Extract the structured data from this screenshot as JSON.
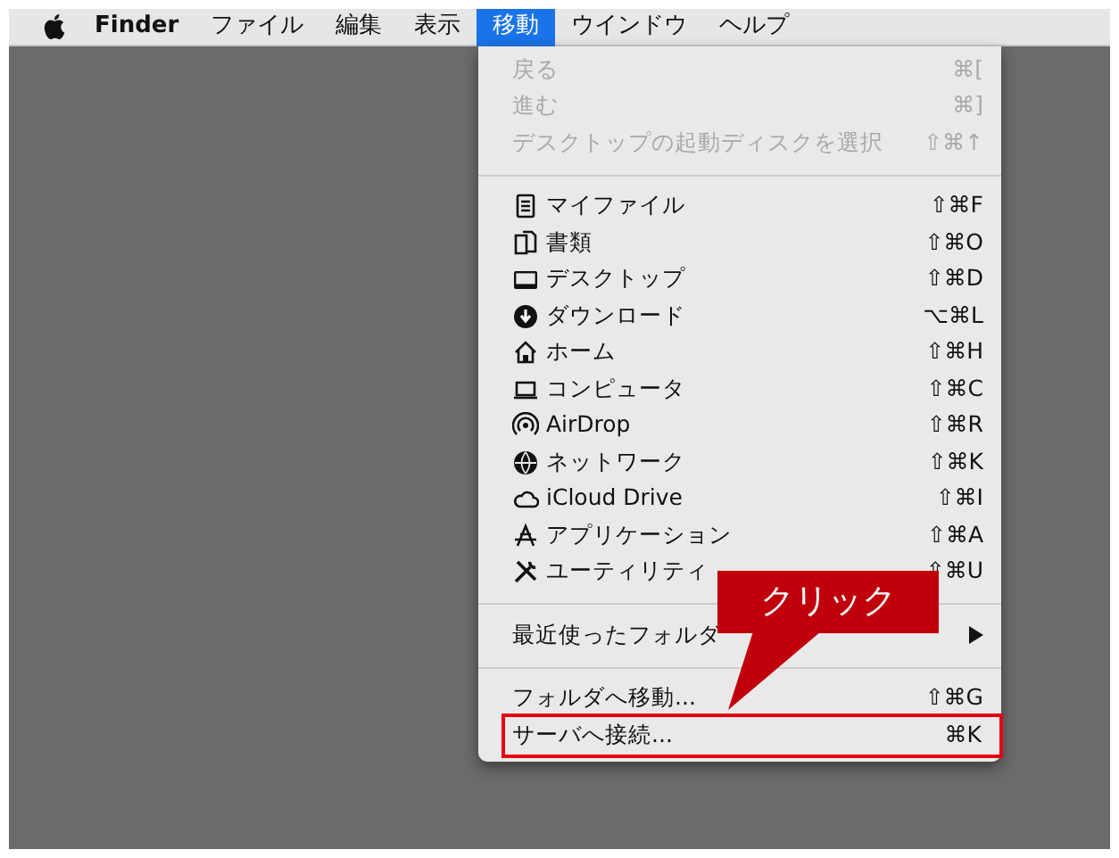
{
  "menubar": [
    {
      "label": "Finder",
      "kind": "app",
      "selected": false
    },
    {
      "label": "ファイル",
      "kind": "menu",
      "selected": false
    },
    {
      "label": "編集",
      "kind": "menu",
      "selected": false
    },
    {
      "label": "表示",
      "kind": "menu",
      "selected": false
    },
    {
      "label": "移動",
      "kind": "menu",
      "selected": true
    },
    {
      "label": "ウインドウ",
      "kind": "menu",
      "selected": false
    },
    {
      "label": "ヘルプ",
      "kind": "menu",
      "selected": false
    }
  ],
  "menu": {
    "items": [
      {
        "kind": "item",
        "label": "戻る",
        "shortcut": "⌘[",
        "disabled": true,
        "marked": false
      },
      {
        "kind": "item",
        "label": "進む",
        "shortcut": "⌘]",
        "disabled": true,
        "marked": false
      },
      {
        "kind": "item",
        "label": "デスクトップの起動ディスクを選択",
        "shortcut": "⇧⌘↑",
        "disabled": true,
        "marked": false
      },
      {
        "kind": "separator"
      },
      {
        "kind": "place",
        "label": "マイファイル",
        "shortcut": "⇧⌘F",
        "disabled": false,
        "marked": false
      },
      {
        "kind": "place",
        "label": "書類",
        "shortcut": "⇧⌘O",
        "disabled": false,
        "marked": false
      },
      {
        "kind": "place",
        "label": "デスクトップ",
        "shortcut": "⇧⌘D",
        "disabled": false,
        "marked": false
      },
      {
        "kind": "place",
        "label": "ダウンロード",
        "shortcut": "⌥⌘L",
        "disabled": false,
        "marked": false
      },
      {
        "kind": "place",
        "label": "ホーム",
        "shortcut": "⇧⌘H",
        "disabled": false,
        "marked": false
      },
      {
        "kind": "place",
        "label": "コンピュータ",
        "shortcut": "⇧⌘C",
        "disabled": false,
        "marked": false
      },
      {
        "kind": "place",
        "label": "AirDrop",
        "shortcut": "⇧⌘R",
        "disabled": false,
        "marked": false
      },
      {
        "kind": "place",
        "label": "ネットワーク",
        "shortcut": "⇧⌘K",
        "disabled": false,
        "marked": false
      },
      {
        "kind": "place",
        "label": "iCloud Drive",
        "shortcut": "⇧⌘I",
        "disabled": false,
        "marked": false
      },
      {
        "kind": "place",
        "label": "アプリケーション",
        "shortcut": "⇧⌘A",
        "disabled": false,
        "marked": false
      },
      {
        "kind": "place",
        "label": "ユーティリティ",
        "shortcut": "⇧⌘U",
        "disabled": false,
        "marked": false
      },
      {
        "kind": "separator"
      },
      {
        "kind": "submenu",
        "label": "最近使ったフォルダ",
        "disabled": false,
        "marked": false
      },
      {
        "kind": "separator"
      },
      {
        "kind": "item",
        "label": "フォルダへ移動...",
        "shortcut": "⇧⌘G",
        "disabled": false,
        "marked": false
      },
      {
        "kind": "item",
        "label": "サーバへ接続...",
        "shortcut": "⌘K",
        "disabled": false,
        "marked": true
      }
    ]
  },
  "callout": {
    "text": "クリック"
  }
}
